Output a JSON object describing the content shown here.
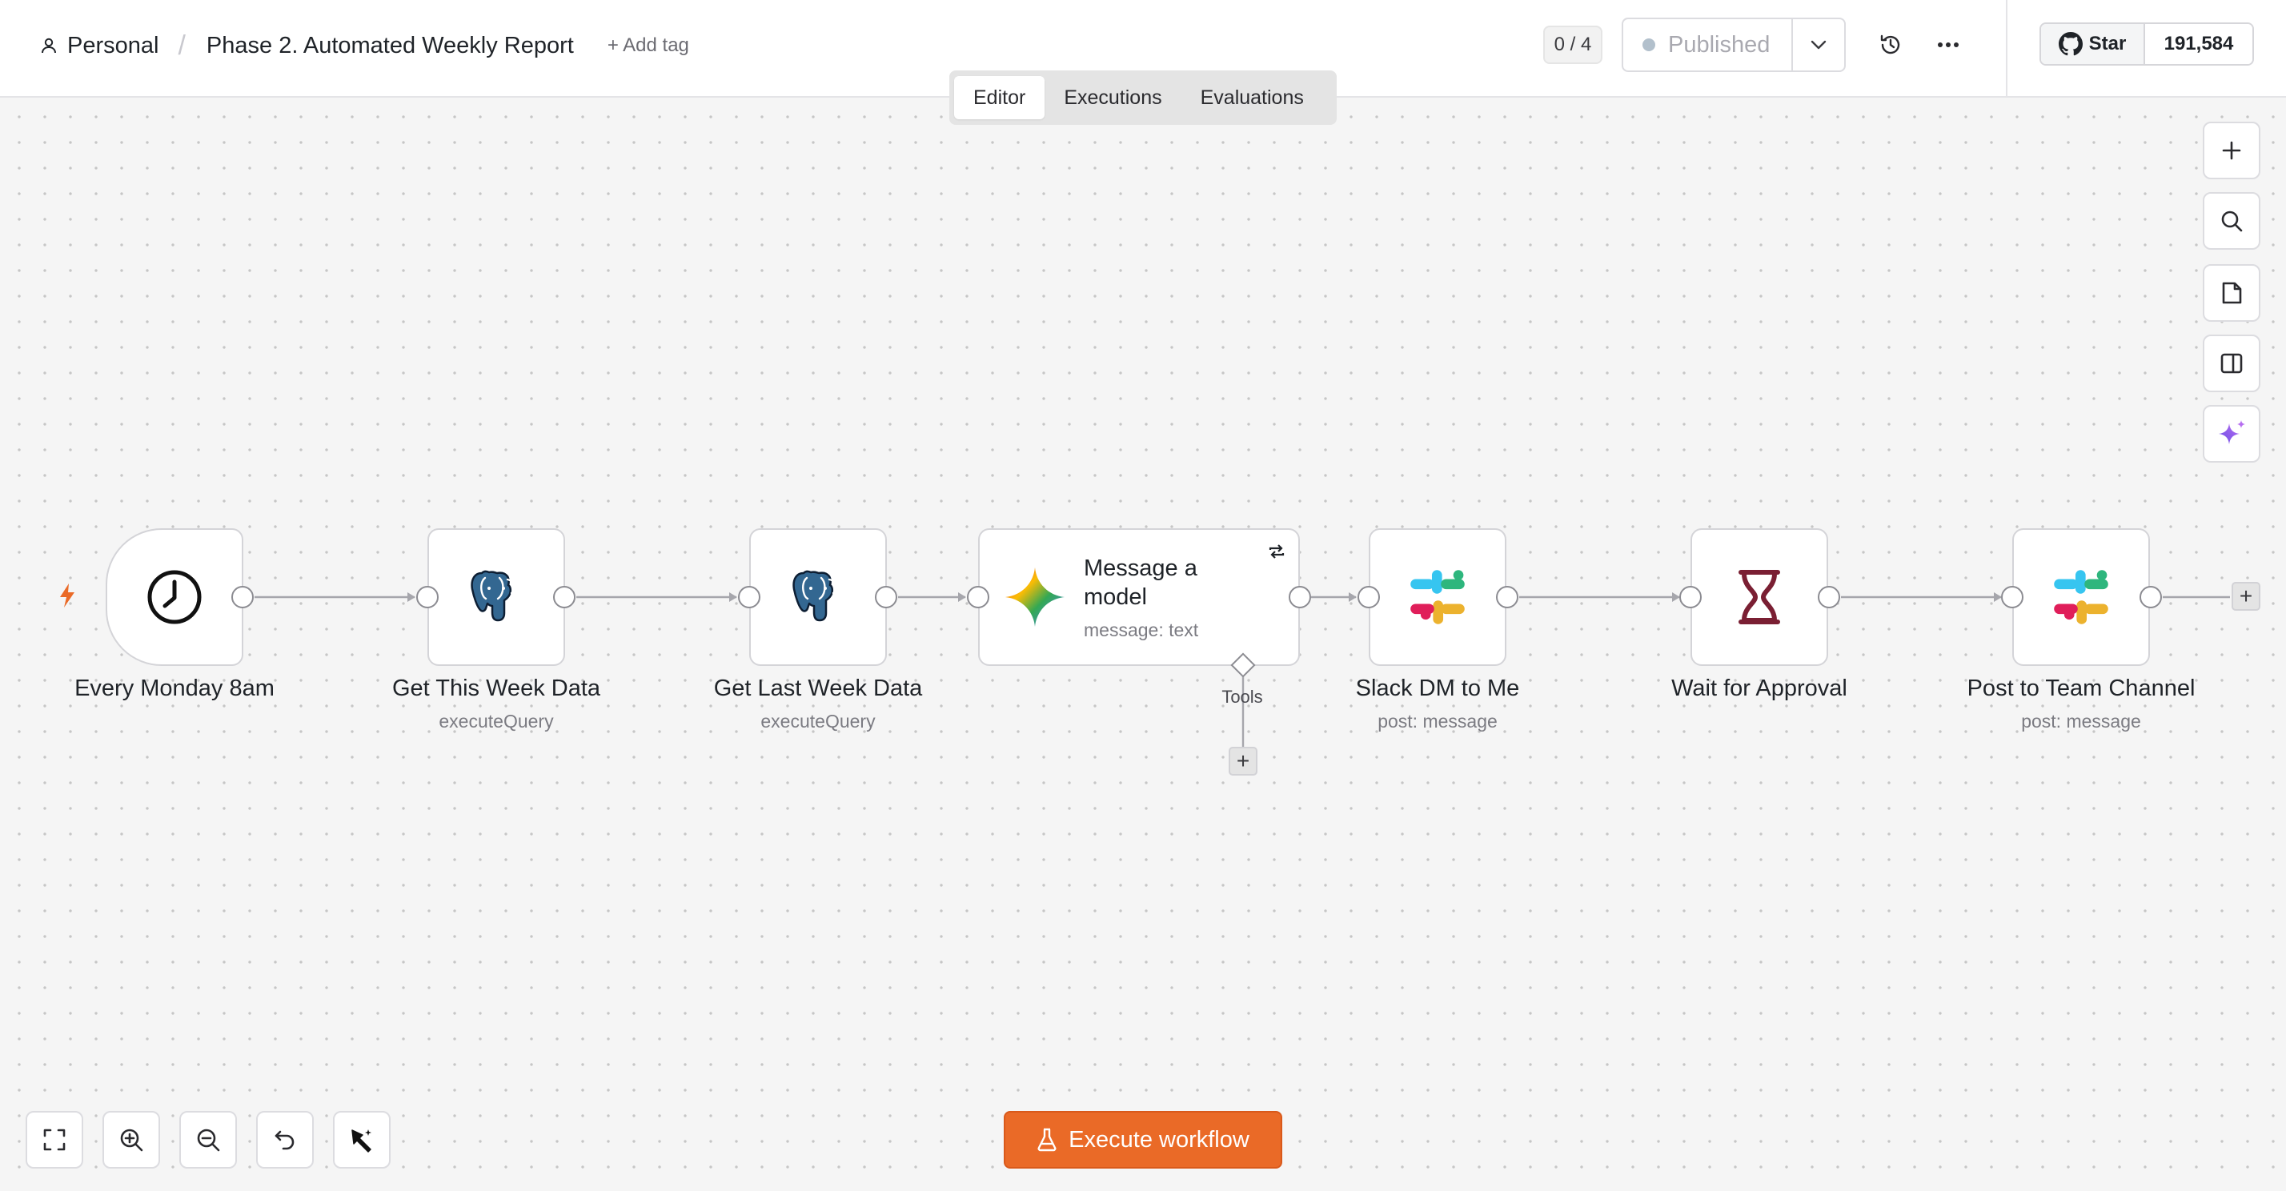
{
  "header": {
    "project": "Personal",
    "separator": "/",
    "workflow_title": "Phase 2. Automated Weekly Report",
    "add_tag": "+ Add tag",
    "counter": "0 / 4",
    "publish_label": "Published",
    "github_star": "Star",
    "github_count": "191,584"
  },
  "tabs": [
    {
      "label": "Editor",
      "active": true
    },
    {
      "label": "Executions",
      "active": false
    },
    {
      "label": "Evaluations",
      "active": false
    }
  ],
  "nodes": [
    {
      "title": "Every Monday 8am",
      "subtitle": "",
      "icon": "clock-icon"
    },
    {
      "title": "Get This Week Data",
      "subtitle": "executeQuery",
      "icon": "postgres-icon"
    },
    {
      "title": "Get Last Week Data",
      "subtitle": "executeQuery",
      "icon": "postgres-icon"
    },
    {
      "title": "Message a model",
      "subtitle": "message: text",
      "icon": "gemini-icon"
    },
    {
      "title": "Slack DM to Me",
      "subtitle": "post: message",
      "icon": "slack-icon"
    },
    {
      "title": "Wait for Approval",
      "subtitle": "",
      "icon": "hourglass-icon"
    },
    {
      "title": "Post to Team Channel",
      "subtitle": "post: message",
      "icon": "slack-icon"
    }
  ],
  "tools_label": "Tools",
  "add_symbol": "+",
  "execute_label": "Execute workflow",
  "right_toolbar": [
    "plus-icon",
    "search-icon",
    "sticky-note-icon",
    "panel-icon",
    "ai-sparkle-icon"
  ],
  "bottom_toolbar": [
    "fit-view-icon",
    "zoom-in-icon",
    "zoom-out-icon",
    "undo-icon",
    "tidy-up-icon"
  ],
  "colors": {
    "accent": "#ea6a27",
    "canvas": "#f5f5f5",
    "node_border": "#d4d4d8",
    "postgres": "#336791",
    "wait": "#7a1f33"
  }
}
